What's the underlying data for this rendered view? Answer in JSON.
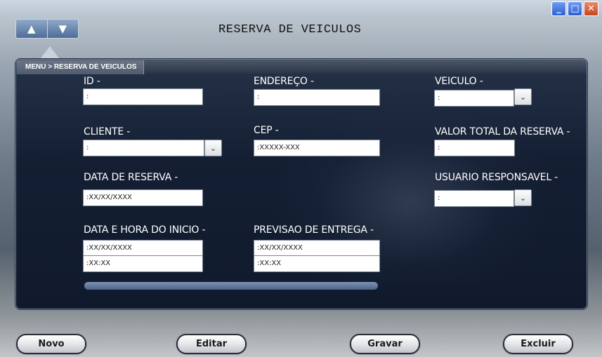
{
  "window": {
    "title": "RESERVA DE VEICULOS",
    "controls": {
      "minimize": "_",
      "maximize": "□",
      "close": "✕"
    }
  },
  "nav": {
    "up": "▲",
    "down": "▼"
  },
  "breadcrumb": "MENU > RESERVA DE VEICULOS",
  "form": {
    "id": {
      "label": "ID -",
      "value": ":"
    },
    "endereco": {
      "label": "ENDEREÇO -",
      "value": ":"
    },
    "veiculo": {
      "label": "VEICULO -",
      "value": ":"
    },
    "cliente": {
      "label": "CLIENTE -",
      "value": ":"
    },
    "cep": {
      "label": "CEP -",
      "value": ":XXXXX-XXX"
    },
    "valor_total": {
      "label": "VALOR TOTAL DA RESERVA -",
      "value": ":"
    },
    "data_reserva": {
      "label": "DATA DE RESERVA -",
      "value": ":XX/XX/XXXX"
    },
    "usuario": {
      "label": "USUARIO RESPONSAVEL -",
      "value": ":"
    },
    "inicio": {
      "label": "DATA E HORA DO INICIO -",
      "date": ":XX/XX/XXXX",
      "time": ":XX:XX"
    },
    "entrega": {
      "label": "PREVISAO DE ENTREGA -",
      "date": ":XX/XX/XXXX",
      "time": ":XX:XX"
    }
  },
  "buttons": {
    "novo": "Novo",
    "editar": "Editar",
    "gravar": "Gravar",
    "excluir": "Excluir"
  },
  "icons": {
    "dropdown": "chevron-down-icon",
    "nav_up": "arrow-up-icon",
    "nav_down": "arrow-down-icon"
  }
}
